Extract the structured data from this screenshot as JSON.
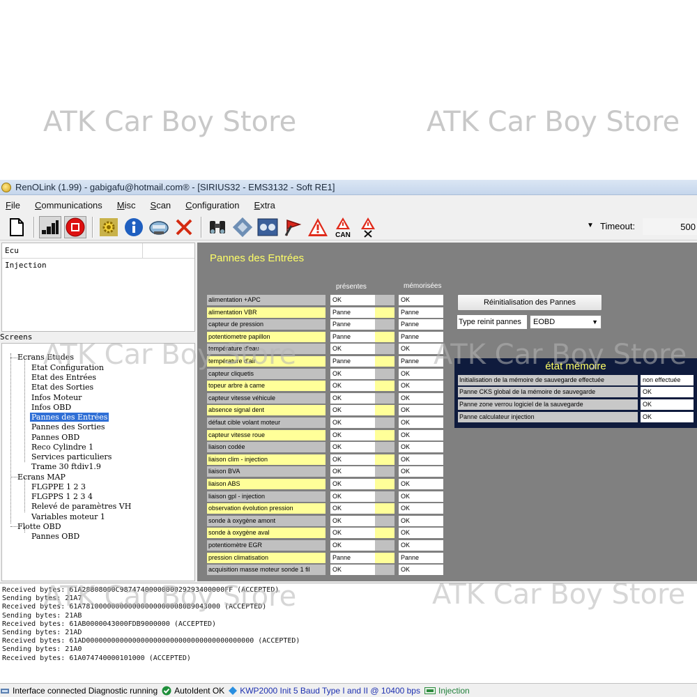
{
  "watermarks": {
    "text": "ATK Car Boy Store"
  },
  "window": {
    "title": "RenOLink (1.99) - gabigafu@hotmail.com® - [SIRIUS32 - EMS3132 - Soft RE1]"
  },
  "menu": [
    "File",
    "Communications",
    "Misc",
    "Scan",
    "Configuration",
    "Extra"
  ],
  "toolbar": {
    "icons": [
      "new-document-icon",
      "signal-bars-icon",
      "stop-icon",
      "gear-icon",
      "info-icon",
      "car-icon",
      "close-icon",
      "binoculars-icon",
      "tool-icon",
      "dashboard-icon",
      "flag-icon",
      "warning-icon",
      "warning-can-icon",
      "warning-clear-icon"
    ],
    "can_label": "CAN",
    "timeout_label": "Timeout:",
    "timeout_value": "500"
  },
  "ecu_panel": {
    "header": "Ecu",
    "rows": [
      "Injection"
    ]
  },
  "screens": {
    "label": "Screens",
    "tree": [
      "Ecrans Etudes",
      "Etat Configuration",
      "Etat des Entrées",
      "Etat des Sorties",
      "Infos Moteur",
      "Infos OBD",
      "Pannes des Entrées",
      "Pannes des Sorties",
      "Pannes OBD",
      "Reco Cylindre 1",
      "Services particuliers",
      "Trame 30 ftdiv1.9",
      "Ecrans MAP",
      "FLGPPE 1 2 3",
      "FLGPPS 1 2 3 4",
      "Relevé de paramètres VH",
      "Variables moteur 1",
      "Flotte OBD",
      "Pannes OBD"
    ]
  },
  "main": {
    "heading": "Pannes des Entrées",
    "col_presentes": "présentes",
    "col_memorisees": "mémorisées",
    "signals": [
      {
        "label": "alimentation +APC",
        "pres": "OK",
        "mem": "OK"
      },
      {
        "label": "alimentation VBR",
        "pres": "Panne",
        "mem": "Panne"
      },
      {
        "label": "capteur de pression",
        "pres": "Panne",
        "mem": "Panne"
      },
      {
        "label": "potentiometre papillon",
        "pres": "Panne",
        "mem": "Panne"
      },
      {
        "label": "température d'eau",
        "pres": "OK",
        "mem": "OK"
      },
      {
        "label": "température d'air",
        "pres": "Panne",
        "mem": "Panne"
      },
      {
        "label": "capteur cliquetis",
        "pres": "OK",
        "mem": "OK"
      },
      {
        "label": "topeur arbre à came",
        "pres": "OK",
        "mem": "OK"
      },
      {
        "label": "capteur vitesse véhicule",
        "pres": "OK",
        "mem": "OK"
      },
      {
        "label": "absence signal dent",
        "pres": "OK",
        "mem": "OK"
      },
      {
        "label": "défaut cible volant moteur",
        "pres": "OK",
        "mem": "OK"
      },
      {
        "label": "capteur vitesse roue",
        "pres": "OK",
        "mem": "OK"
      },
      {
        "label": "liaison codée",
        "pres": "OK",
        "mem": "OK"
      },
      {
        "label": "liaison clim - injection",
        "pres": "OK",
        "mem": "OK"
      },
      {
        "label": "liaison BVA",
        "pres": "OK",
        "mem": "OK"
      },
      {
        "label": "liaison ABS",
        "pres": "OK",
        "mem": "OK"
      },
      {
        "label": "liaison gpl - injection",
        "pres": "OK",
        "mem": "OK"
      },
      {
        "label": "observation évolution pression",
        "pres": "OK",
        "mem": "OK"
      },
      {
        "label": "sonde à oxygène amont",
        "pres": "OK",
        "mem": "OK"
      },
      {
        "label": "sonde à oxygène aval",
        "pres": "OK",
        "mem": "OK"
      },
      {
        "label": "potentiomètre EGR",
        "pres": "OK",
        "mem": "OK"
      },
      {
        "label": "pression climatisation",
        "pres": "Panne",
        "mem": "Panne"
      },
      {
        "label": "acquisition masse moteur sonde 1 fil",
        "pres": "OK",
        "mem": "OK"
      }
    ],
    "reinit_button": "Réinitialisation des Pannes",
    "type_label": "Type reinit pannes",
    "type_value": "EOBD",
    "memory": {
      "title": "état mémoire",
      "rows": [
        {
          "label": "Initialisation de la mémoire de sauvegarde effectuée",
          "value": "non effectuée"
        },
        {
          "label": "Panne CKS global de la mémoire de sauvegarde",
          "value": "OK"
        },
        {
          "label": "Panne zone verrou logiciel de la sauvegarde",
          "value": "OK"
        },
        {
          "label": "Panne calculateur injection",
          "value": "OK"
        }
      ]
    }
  },
  "log": [
    "Received bytes: 61A28808000C9874740000000029293400000FF (ACCEPTED)",
    "Sending bytes: 21A7",
    "Received bytes: 61A7810000000000000000000080B9043000 (ACCEPTED)",
    "Sending bytes: 21AB",
    "Received bytes: 61AB0000043000FDB9000000 (ACCEPTED)",
    "Sending bytes: 21AD",
    "Received bytes: 61AD0000000000000000000000000000000000000000 (ACCEPTED)",
    "Sending bytes: 21A0",
    "Received bytes: 61A074740000101000 (ACCEPTED)"
  ],
  "status": {
    "interface": "Interface connected Diagnostic running",
    "autoident": "AutoIdent OK",
    "protocol": "KWP2000 Init 5 Baud Type I and II @ 10400 bps",
    "ecu": "Injection"
  }
}
